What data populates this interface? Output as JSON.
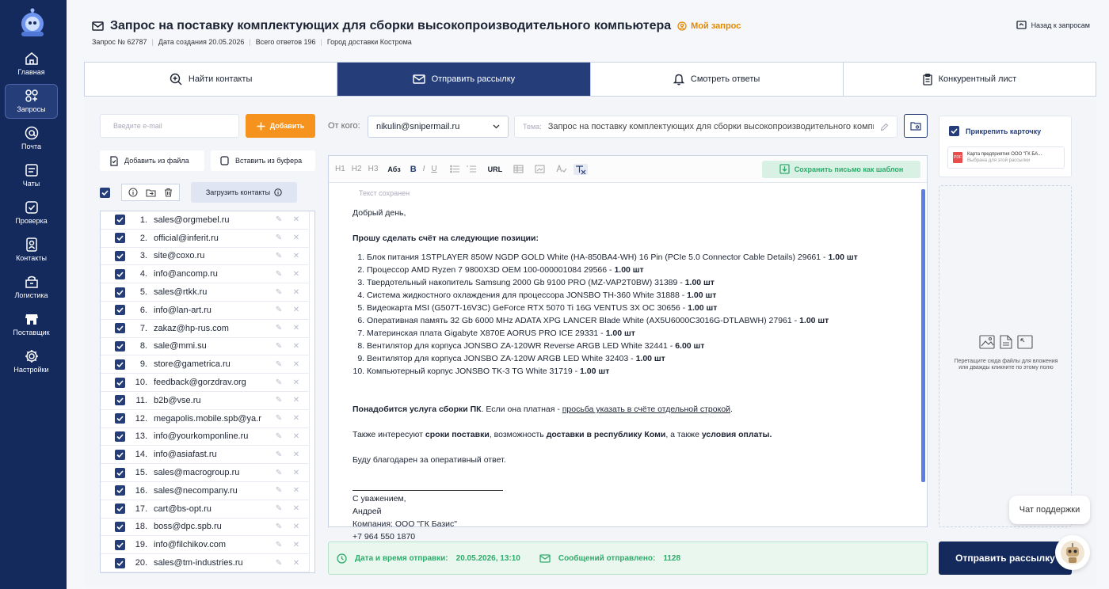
{
  "sidebar": {
    "items": [
      {
        "label": "Главная",
        "icon": "home-icon"
      },
      {
        "label": "Запросы",
        "icon": "requests-icon",
        "active": true
      },
      {
        "label": "Почта",
        "icon": "at-icon"
      },
      {
        "label": "Чаты",
        "icon": "chat-icon"
      },
      {
        "label": "Проверка",
        "icon": "check-icon"
      },
      {
        "label": "Контакты",
        "icon": "contacts-icon"
      },
      {
        "label": "Логистика",
        "icon": "logistics-icon"
      },
      {
        "label": "Поставщик",
        "icon": "supplier-icon"
      },
      {
        "label": "Настройки",
        "icon": "gear-icon"
      }
    ]
  },
  "header": {
    "title": "Запрос на поставку комплектующих для сборки высокопроизводительного компьютера",
    "my_badge": "Мой запрос",
    "meta": {
      "request_no": "Запрос № 62787",
      "created": "Дата создания 20.05.2026",
      "answers": "Всего ответов 196",
      "city": "Город доставки Кострома"
    },
    "back": "Назад к запросам"
  },
  "tabs": [
    {
      "label": "Найти контакты",
      "icon": "search-plus-icon"
    },
    {
      "label": "Отправить рассылку",
      "icon": "mail-icon",
      "active": true
    },
    {
      "label": "Смотреть ответы",
      "icon": "bell-icon"
    },
    {
      "label": "Конкурентный лист",
      "icon": "clipboard-icon"
    }
  ],
  "contacts": {
    "email_placeholder": "Введите e-mail",
    "add_label": "Добавить",
    "from_file": "Добавить из файла",
    "from_clipboard": "Вставить из буфера",
    "load_contacts": "Загрузить контакты",
    "rows": [
      {
        "n": "1.",
        "email": "sales@orgmebel.ru"
      },
      {
        "n": "2.",
        "email": "official@inferit.ru"
      },
      {
        "n": "3.",
        "email": "site@coxo.ru"
      },
      {
        "n": "4.",
        "email": "info@ancomp.ru"
      },
      {
        "n": "5.",
        "email": "sales@rtkk.ru"
      },
      {
        "n": "6.",
        "email": "info@lan-art.ru"
      },
      {
        "n": "7.",
        "email": "zakaz@hp-rus.com"
      },
      {
        "n": "8.",
        "email": "sale@mmi.su"
      },
      {
        "n": "9.",
        "email": "store@gametrica.ru"
      },
      {
        "n": "10.",
        "email": "feedback@gorzdrav.org"
      },
      {
        "n": "11.",
        "email": "b2b@vse.ru"
      },
      {
        "n": "12.",
        "email": "megapolis.mobile.spb@ya.r"
      },
      {
        "n": "13.",
        "email": "info@yourkomponline.ru"
      },
      {
        "n": "14.",
        "email": "info@asiafast.ru"
      },
      {
        "n": "15.",
        "email": "sales@macrogroup.ru"
      },
      {
        "n": "16.",
        "email": "sales@necompany.ru"
      },
      {
        "n": "17.",
        "email": "cart@bs-opt.ru"
      },
      {
        "n": "18.",
        "email": "boss@dpc.spb.ru"
      },
      {
        "n": "19.",
        "email": "info@filchikov.com"
      },
      {
        "n": "20.",
        "email": "sales@tm-industries.ru"
      }
    ]
  },
  "compose": {
    "from_label": "От кого:",
    "from_value": "nikulin@snipermail.ru",
    "topic_label": "Тема:",
    "topic_value": "Запрос на поставку комплектующих для сборки высокопроизводительного компьютера",
    "toolbar": {
      "h1": "H1",
      "h2": "H2",
      "h3": "H3",
      "abz": "Абз",
      "bold": "B",
      "italic": "I",
      "underline": "U",
      "url": "URL"
    },
    "save_template": "Сохранить письмо как шаблон",
    "saved_note": "Текст сохранен",
    "greeting": "Добрый день,",
    "intro": "Прошу сделать счёт на следующие позиции:",
    "items": [
      {
        "name": "Блок питания 1STPLAYER 850W NGDP GOLD White (HA-850BA4-WH) 16 Pin (PCIe 5.0 Connector Cable Details) 29661",
        "qty": "1.00 шт"
      },
      {
        "name": "Процессор AMD Ryzen 7 9800X3D OEM 100-000001084 29566",
        "qty": "1.00 шт"
      },
      {
        "name": "Твердотельный накопитель Samsung 2000 Gb 9100 PRO (MZ-VAP2T0BW) 31389",
        "qty": "1.00 шт"
      },
      {
        "name": "Система жидкостного охлаждения для процессора JONSBO TH-360 White 31888",
        "qty": "1.00 шт"
      },
      {
        "name": "Видеокарта MSI (G507T-16V3C) GeForce RTX 5070 Ti 16G VENTUS 3X OC 30656",
        "qty": "1.00 шт"
      },
      {
        "name": "Оперативная память 32 Gb 6000 MHz ADATA XPG LANCER Blade White (AX5U6000C3016G-DTLABWH) 27961",
        "qty": "1.00 шт"
      },
      {
        "name": "Материнская плата Gigabyte X870E AORUS PRO ICE 29331",
        "qty": "1.00 шт"
      },
      {
        "name": "Вентилятор для корпуса JONSBO ZA-120WR Reverse ARGB LED White 32441",
        "qty": "6.00 шт"
      },
      {
        "name": "Вентилятор для корпуса JONSBO ZA-120W ARGB LED White 32403",
        "qty": "1.00 шт"
      },
      {
        "name": "Компьютерный корпус JONSBO TK-3 TG White 31719",
        "qty": "1.00 шт"
      }
    ],
    "service_bold": "Понадобится услуга сборки ПК",
    "service_mid": ". Если она платная - ",
    "service_link": "просьба указать в счёте отдельной строкой",
    "also_1": "Также интересуют ",
    "also_b1": "сроки поставки",
    "also_2": ", возможность ",
    "also_b2": "доставки в республику Коми",
    "also_3": ", а также ",
    "also_b3": "условия оплаты.",
    "thanks": "Буду благодарен за оперативный ответ.",
    "regards": "С уважением,",
    "name": "Андрей",
    "company": "Компания: ООО \"ГК Базис\"",
    "phone": "+7 964 550 1870"
  },
  "footer": {
    "date_label": "Дата и время отправки:",
    "date_value": "20.05.2026, 13:10",
    "sent_label": "Сообщений отправлено:",
    "sent_value": "1128"
  },
  "attach": {
    "label": "Прикрепить карточку",
    "card_title": "Карта предприятия ООО \"ГК БА...",
    "card_sub": "Выбрана для этой рассылки",
    "pdf": "PDF",
    "drop_text": "Перетащите сюда файлы для вложения или дважды кликните по этому полю"
  },
  "send_button": "Отправить рассылку",
  "support": "Чат поддержки",
  "colors": {
    "navy": "#142a5c",
    "orange": "#f6931e",
    "green": "#2eab6b",
    "badge": "#e58a00"
  }
}
